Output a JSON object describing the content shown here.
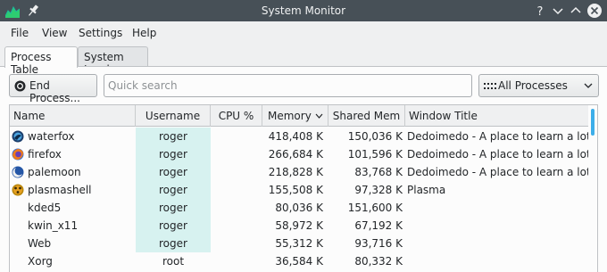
{
  "window": {
    "title": "System Monitor"
  },
  "menu": [
    {
      "label": "File"
    },
    {
      "label": "View"
    },
    {
      "label": "Settings"
    },
    {
      "label": "Help"
    }
  ],
  "tabs": [
    {
      "label": "Process Table",
      "active": true
    },
    {
      "label": "System Load",
      "active": false
    }
  ],
  "toolbar": {
    "end_process_label": "End Process...",
    "search_placeholder": "Quick search",
    "filter_value": "All Processes"
  },
  "columns": [
    "Name",
    "Username",
    "CPU %",
    "Memory",
    "Shared Mem",
    "Window Title"
  ],
  "sort_column": "Memory",
  "rows": [
    {
      "name": "waterfox",
      "icon": "waterfox-icon",
      "user": "roger",
      "cpu": "",
      "memory": "418,408 K",
      "shared": "150,036 K",
      "window": "Dedoimedo - A place to learn a lot a..."
    },
    {
      "name": "firefox",
      "icon": "firefox-icon",
      "user": "roger",
      "cpu": "",
      "memory": "266,684 K",
      "shared": "101,596 K",
      "window": "Dedoimedo - A place to learn a lot a..."
    },
    {
      "name": "palemoon",
      "icon": "palemoon-icon",
      "user": "roger",
      "cpu": "",
      "memory": "218,828 K",
      "shared": "83,768 K",
      "window": "Dedoimedo - A place to learn a lot a..."
    },
    {
      "name": "plasmashell",
      "icon": "plasma-icon",
      "user": "roger",
      "cpu": "",
      "memory": "155,508 K",
      "shared": "97,328 K",
      "window": "Plasma"
    },
    {
      "name": "kded5",
      "icon": "",
      "user": "roger",
      "cpu": "",
      "memory": "80,036 K",
      "shared": "151,600 K",
      "window": ""
    },
    {
      "name": "kwin_x11",
      "icon": "",
      "user": "roger",
      "cpu": "",
      "memory": "58,972 K",
      "shared": "67,192 K",
      "window": ""
    },
    {
      "name": "Web",
      "icon": "",
      "user": "roger",
      "cpu": "",
      "memory": "55,312 K",
      "shared": "93,716 K",
      "window": ""
    },
    {
      "name": "Xorg",
      "icon": "",
      "user": "root",
      "cpu": "",
      "memory": "36,584 K",
      "shared": "80,332 K",
      "window": ""
    }
  ],
  "colors": {
    "titlebar": "#475057",
    "accent": "#3daee9",
    "user_highlight": "#d7f2f0"
  }
}
